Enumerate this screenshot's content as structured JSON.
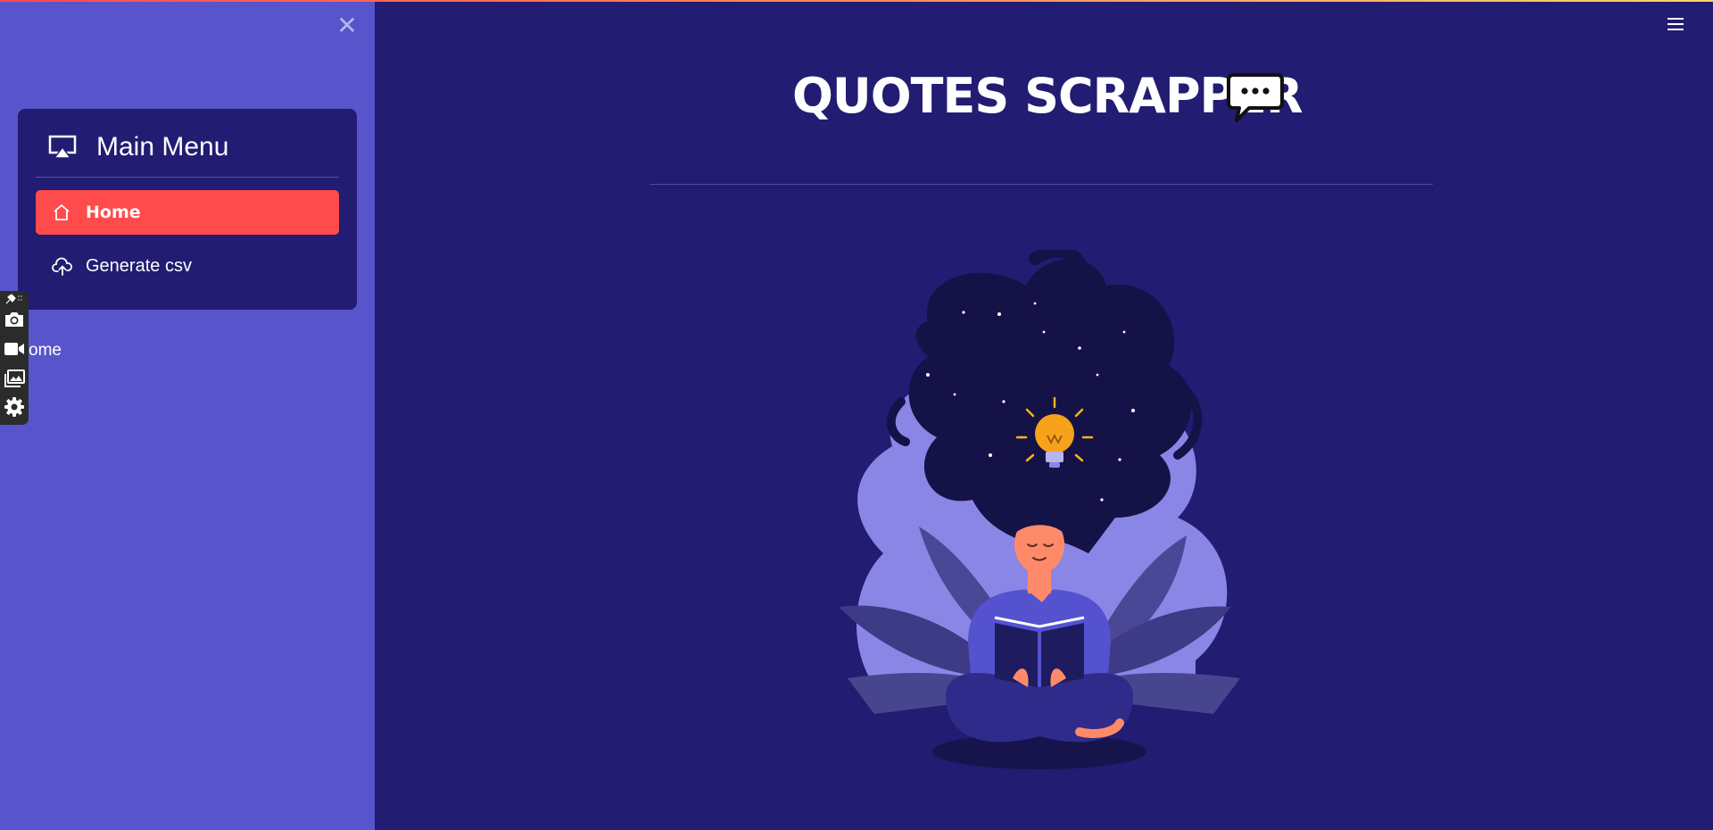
{
  "sidebar": {
    "close_icon": "close-icon",
    "menu": {
      "title": "Main Menu",
      "icon": "airplay-icon",
      "items": [
        {
          "label": "Home",
          "icon": "house-icon",
          "active": true
        },
        {
          "label": "Generate csv",
          "icon": "cloud-upload-icon",
          "active": false
        }
      ]
    },
    "caption": "ome"
  },
  "toolbar": {
    "icons": [
      "pin-icon",
      "camera-icon",
      "video-icon",
      "gallery-icon",
      "gear-icon"
    ]
  },
  "header": {
    "menu_icon": "hamburger-icon"
  },
  "main": {
    "title": "QUOTES SCRAPPER",
    "title_icon": "speech-bubble-icon",
    "illustration": "meditating-reader-lightbulb-illustration"
  },
  "colors": {
    "background": "#221c72",
    "sidebar": "#5854cc",
    "accent": "#ff4b4b",
    "text": "#ffffff"
  }
}
